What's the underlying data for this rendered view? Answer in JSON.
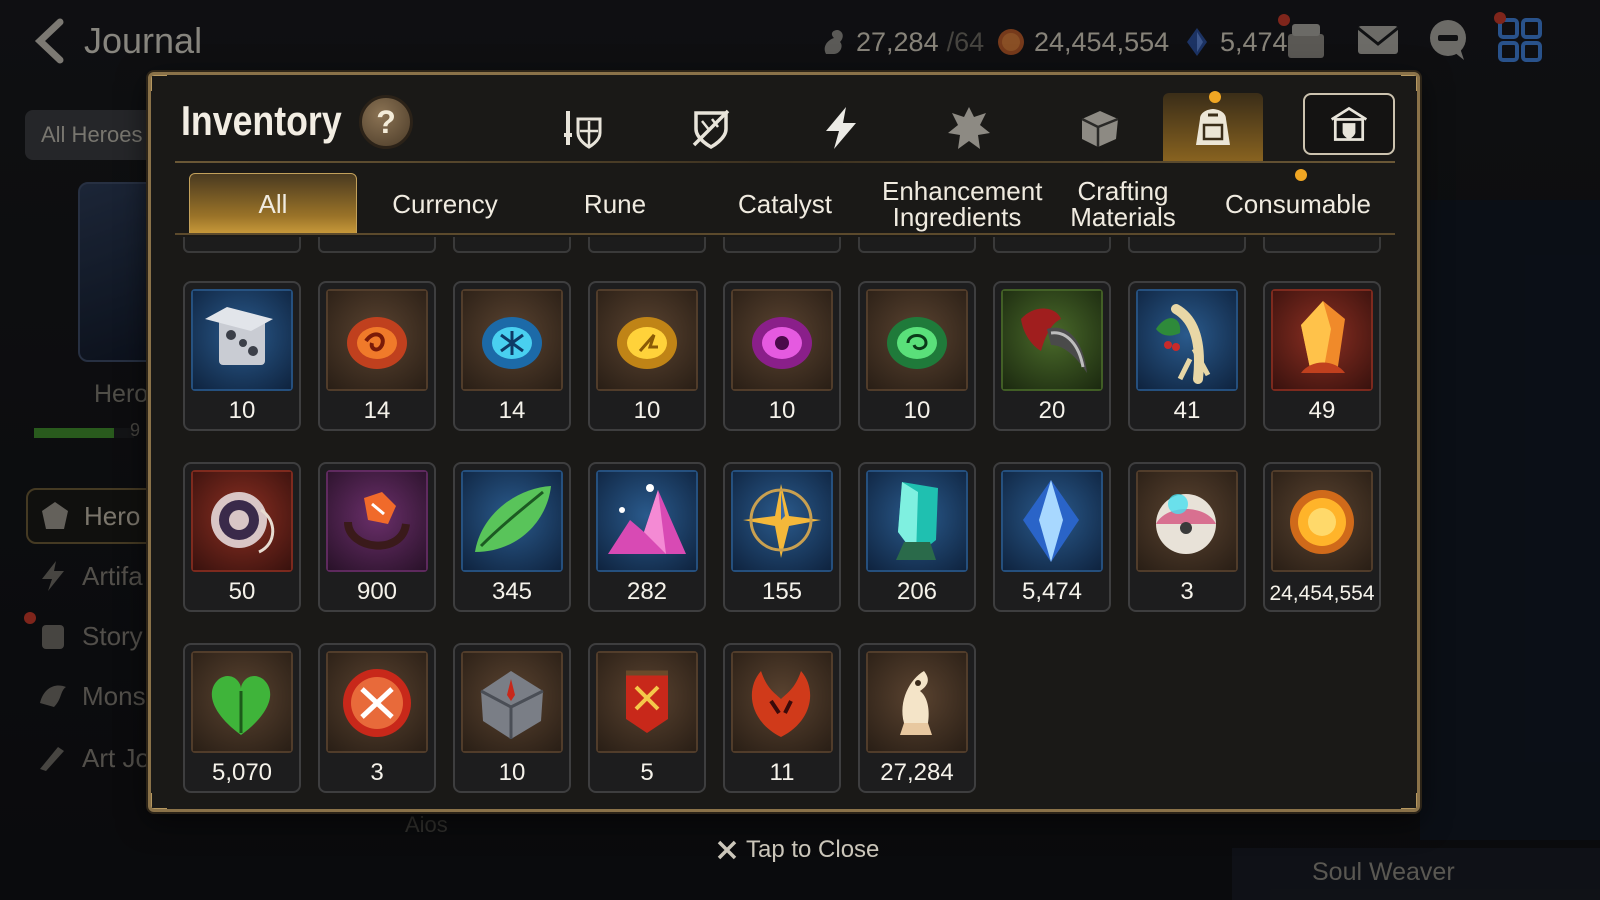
{
  "screen": {
    "title": "Journal",
    "resources": {
      "stamina": {
        "value": "27,284",
        "max": "/64"
      },
      "gold": "24,454,554",
      "skystone": "5,474"
    },
    "filter_button": "All Heroes",
    "hero_label": "Hero",
    "hero_bar_text": "9",
    "side_menu": [
      "Hero",
      "Artifa",
      "Story",
      "Mons",
      "Art Jo"
    ],
    "bg_label_aios": "Aios",
    "bg_label_soul": "Soul Weaver"
  },
  "inventory": {
    "title": "Inventory",
    "help": "?",
    "category_icons": [
      "equipment-icon",
      "shield-broken-icon",
      "lightning-icon",
      "crest-icon",
      "material-box-icon",
      "bag-icon",
      "storage-icon"
    ],
    "tabs": [
      {
        "label": "All"
      },
      {
        "label": "Currency"
      },
      {
        "label": "Rune"
      },
      {
        "label": "Catalyst"
      },
      {
        "label": "Enhancement Ingredients"
      },
      {
        "label": "Crafting Materials"
      },
      {
        "label": "Consumable"
      }
    ],
    "items": [
      {
        "name": "mystery-box",
        "qty": "10",
        "bg": "blue"
      },
      {
        "name": "red-rune",
        "qty": "14",
        "bg": "brown"
      },
      {
        "name": "blue-rune",
        "qty": "14",
        "bg": "brown"
      },
      {
        "name": "yellow-rune",
        "qty": "10",
        "bg": "brown"
      },
      {
        "name": "purple-rune",
        "qty": "10",
        "bg": "brown"
      },
      {
        "name": "green-rune",
        "qty": "10",
        "bg": "brown"
      },
      {
        "name": "claw",
        "qty": "20",
        "bg": "green"
      },
      {
        "name": "herb-root",
        "qty": "41",
        "bg": "blue"
      },
      {
        "name": "fire-crystal",
        "qty": "49",
        "bg": "red"
      },
      {
        "name": "red-charm",
        "qty": "50",
        "bg": "red"
      },
      {
        "name": "purple-charm",
        "qty": "900",
        "bg": "purple"
      },
      {
        "name": "leaf",
        "qty": "345",
        "bg": "blue"
      },
      {
        "name": "pink-crystal",
        "qty": "282",
        "bg": "blue"
      },
      {
        "name": "star-compass",
        "qty": "155",
        "bg": "blue"
      },
      {
        "name": "teal-crystal",
        "qty": "206",
        "bg": "blue"
      },
      {
        "name": "skystone",
        "qty": "5,474",
        "bg": "blue"
      },
      {
        "name": "pet-orb",
        "qty": "3",
        "bg": "brown"
      },
      {
        "name": "gold-coin",
        "qty": "24,454,554",
        "bg": "brown"
      },
      {
        "name": "heart-leaf",
        "qty": "5,070",
        "bg": "brown"
      },
      {
        "name": "war-badge",
        "qty": "3",
        "bg": "brown"
      },
      {
        "name": "stone-compass",
        "qty": "10",
        "bg": "brown"
      },
      {
        "name": "banner",
        "qty": "5",
        "bg": "brown"
      },
      {
        "name": "fire-leaf",
        "qty": "11",
        "bg": "brown"
      },
      {
        "name": "stamina-knight",
        "qty": "27,284",
        "bg": "brown"
      }
    ],
    "close_hint": "Tap to Close"
  },
  "colors": {
    "accent_gold": "#c99a3a",
    "frame": "#8a7249",
    "notify": "#f0a623"
  }
}
